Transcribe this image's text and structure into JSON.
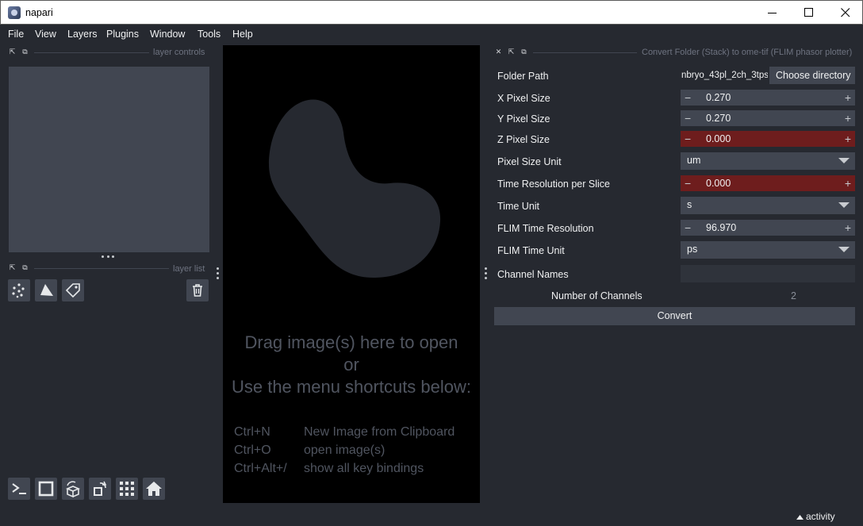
{
  "window": {
    "title": "napari",
    "minimize_glyph": "—",
    "maximize_glyph": "☐",
    "close_glyph": "✕"
  },
  "menu": [
    "File",
    "View",
    "Layers",
    "Plugins",
    "Window",
    "Tools",
    "Help"
  ],
  "left_dock": {
    "layer_controls_title": "layer controls",
    "layer_list_title": "layer list",
    "layer_buttons": [
      "points-icon",
      "shapes-icon",
      "labels-icon"
    ],
    "delete_icon": "trash-icon"
  },
  "canvas": {
    "welcome_lines": [
      "Drag image(s) here to open",
      "or",
      "Use the menu shortcuts below:"
    ],
    "shortcuts": [
      {
        "key": "Ctrl+N",
        "desc": "New Image from Clipboard"
      },
      {
        "key": "Ctrl+O",
        "desc": "open image(s)"
      },
      {
        "key": "Ctrl+Alt+/",
        "desc": "show all key bindings"
      }
    ]
  },
  "plugin": {
    "title": "Convert Folder (Stack) to ome-tif (FLIM phasor plotter)",
    "folder_path_label": "Folder Path",
    "folder_path_value": "nbryo_43pl_2ch_3tps",
    "choose_button": "Choose directory",
    "x_pixel_label": "X Pixel Size",
    "x_pixel_value": "0.270",
    "y_pixel_label": "Y Pixel Size",
    "y_pixel_value": "0.270",
    "z_pixel_label": "Z Pixel Size",
    "z_pixel_value": "0.000",
    "pixel_unit_label": "Pixel Size Unit",
    "pixel_unit_value": "um",
    "time_res_label": "Time Resolution per Slice",
    "time_res_value": "0.000",
    "time_unit_label": "Time Unit",
    "time_unit_value": "s",
    "flim_res_label": "FLIM Time Resolution",
    "flim_res_value": "96.970",
    "flim_unit_label": "FLIM Time Unit",
    "flim_unit_value": "ps",
    "channel_names_label": "Channel Names",
    "channel_names_value": "",
    "num_channels_label": "Number of Channels",
    "num_channels_value": "2",
    "convert_button": "Convert",
    "minus_glyph": "−",
    "plus_glyph": "+"
  },
  "status": {
    "activity": "activity"
  },
  "colors": {
    "bg": "#262930",
    "panel": "#414651",
    "warn": "#6e1d1d",
    "canvas": "#000000",
    "welcome": "#505560"
  }
}
